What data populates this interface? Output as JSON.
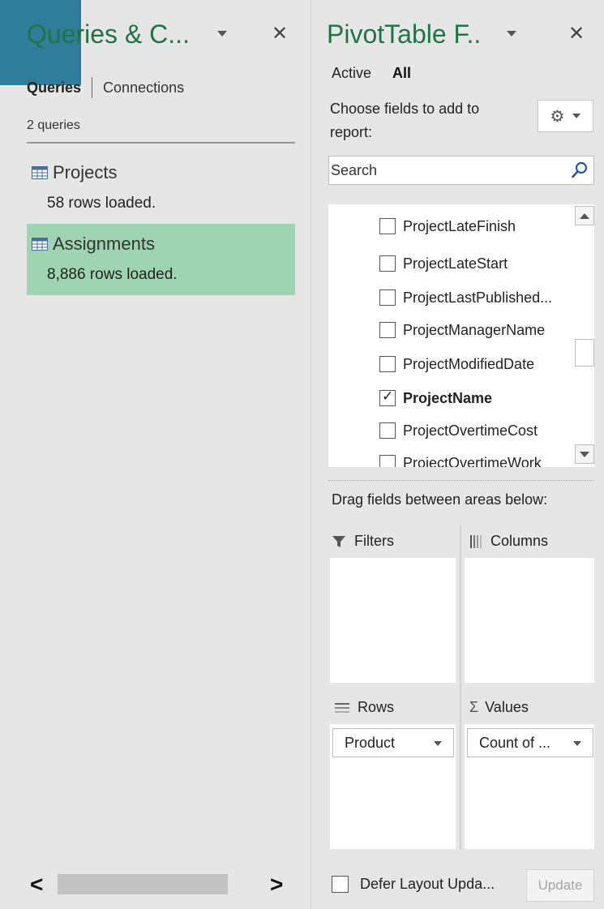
{
  "colors": {
    "accent": "#2f7d9b",
    "title_green": "#217346",
    "selected_bg": "#9fd4b2"
  },
  "queries_pane": {
    "title": "Queries & C...",
    "tabs": {
      "queries": "Queries",
      "connections": "Connections"
    },
    "count": "2 queries",
    "items": [
      {
        "name": "Projects",
        "rows": "58 rows loaded.",
        "selected": false,
        "icon": "table-icon"
      },
      {
        "name": "Assignments",
        "rows": "8,886 rows loaded.",
        "selected": true,
        "icon": "table-icon"
      }
    ]
  },
  "pivot_pane": {
    "title": "PivotTable F..",
    "tabs": {
      "active": "Active",
      "all": "All"
    },
    "instructions": "Choose fields to add to report:",
    "search_placeholder": "Search",
    "fields": [
      {
        "label": "ProjectLateFinish",
        "checked": false
      },
      {
        "label": "ProjectLateStart",
        "checked": false
      },
      {
        "label": "ProjectLastPublished...",
        "checked": false
      },
      {
        "label": "ProjectManagerName",
        "checked": false
      },
      {
        "label": "ProjectModifiedDate",
        "checked": false
      },
      {
        "label": "ProjectName",
        "checked": true
      },
      {
        "label": "ProjectOvertimeCost",
        "checked": false
      },
      {
        "label": "ProjectOvertimeWork",
        "checked": false
      }
    ],
    "drag_label": "Drag fields between areas below:",
    "areas": {
      "filters": {
        "label": "Filters",
        "icon": "filter-icon"
      },
      "columns": {
        "label": "Columns",
        "icon": "columns-icon"
      },
      "rows": {
        "label": "Rows",
        "icon": "rows-icon",
        "items": [
          "Product"
        ]
      },
      "values": {
        "label": "Values",
        "icon": "sigma-icon",
        "items": [
          "Count of ..."
        ]
      }
    },
    "defer_label": "Defer Layout Upda...",
    "update_button": "Update"
  }
}
